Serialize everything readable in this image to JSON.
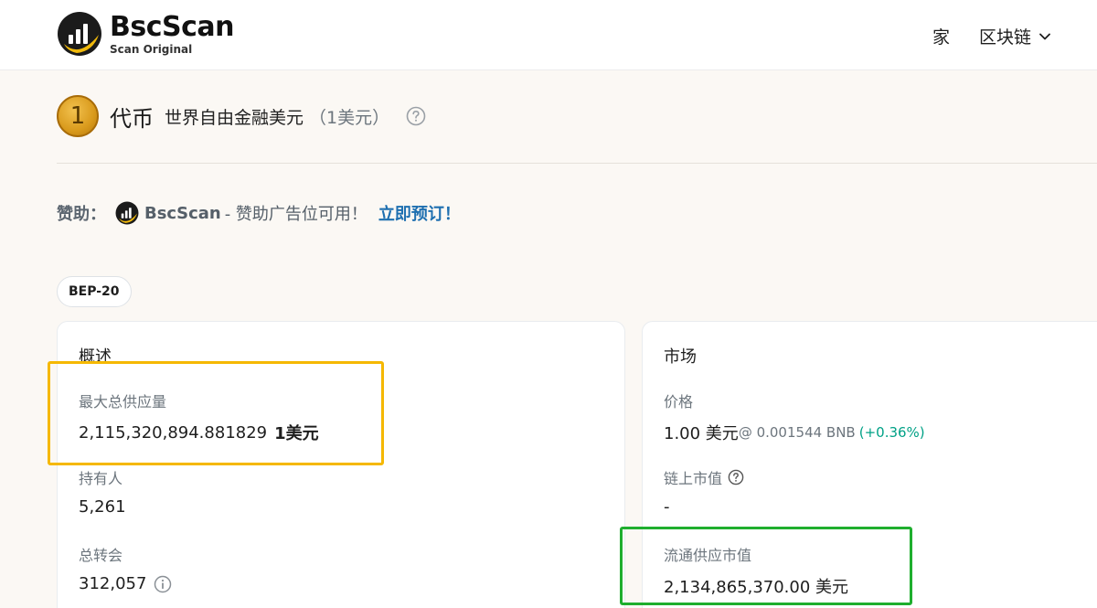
{
  "header": {
    "logo_name": "BscScan",
    "logo_sub": "Scan Original",
    "nav": [
      {
        "label": "家"
      },
      {
        "label": "区块链"
      }
    ]
  },
  "token": {
    "icon_label": "1",
    "label": "代币",
    "name": "世界自由金融美元",
    "symbol": "（1美元）"
  },
  "sponsor": {
    "label": "赞助：",
    "brand": "BscScan",
    "text": "- 赞助广告位可用！",
    "link": "立即预订！"
  },
  "badge": "BEP-20",
  "overview": {
    "title": "概述",
    "max_supply_label": "最大总供应量",
    "max_supply_value": "2,115,320,894.881829",
    "max_supply_unit": "1美元",
    "holders_label": "持有人",
    "holders_value": "5,261",
    "transfers_label": "总转会",
    "transfers_value": "312,057"
  },
  "market": {
    "title": "市场",
    "price_label": "价格",
    "price_value": "1.00 美元",
    "price_bnb": "@ 0.001544 BNB",
    "price_change": "(+0.36%)",
    "onchain_mcap_label": "链上市值",
    "onchain_mcap_value": "-",
    "circ_mcap_label": "流通供应市值",
    "circ_mcap_value": "2,134,865,370.00 美元"
  },
  "colors": {
    "link": "#1e6fb0",
    "positive": "#00a186",
    "highlight_yellow": "#f5b800",
    "highlight_green": "#1fae2e"
  },
  "icons": [
    "bscscan-logo-icon",
    "chevron-down-icon",
    "coin-icon",
    "question-circle-icon",
    "info-circle-icon"
  ]
}
